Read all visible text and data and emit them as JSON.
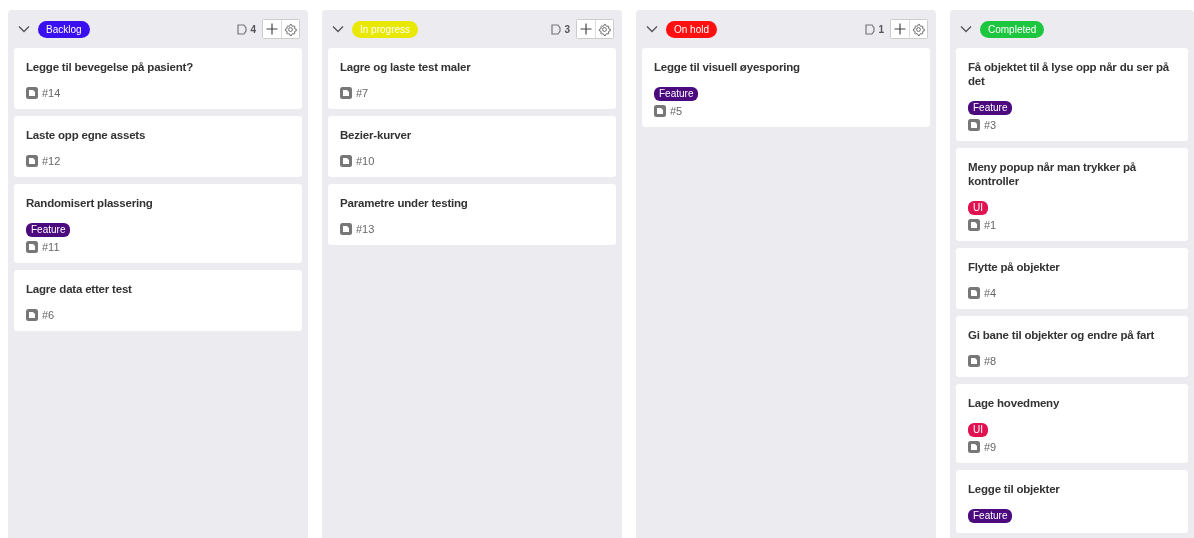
{
  "columns": [
    {
      "status": "Backlog",
      "color": "#3a10f0",
      "count": "4",
      "cards": [
        {
          "title": "Legge til bevegelse på pasient?",
          "issue": "#14"
        },
        {
          "title": "Laste opp egne assets",
          "issue": "#12"
        },
        {
          "title": "Randomisert plassering",
          "labels": [
            {
              "text": "Feature",
              "color": "#4b0a7e"
            }
          ],
          "issue": "#11"
        },
        {
          "title": "Lagre data etter test",
          "issue": "#6"
        }
      ]
    },
    {
      "status": "In progress",
      "color": "#e8e800",
      "count": "3",
      "cards": [
        {
          "title": "Lagre og laste test maler",
          "issue": "#7"
        },
        {
          "title": "Bezier-kurver",
          "issue": "#10"
        },
        {
          "title": "Parametre under testing",
          "issue": "#13"
        }
      ]
    },
    {
      "status": "On hold",
      "color": "#ff1010",
      "count": "1",
      "cards": [
        {
          "title": "Legge til visuell øyesporing",
          "labels": [
            {
              "text": "Feature",
              "color": "#4b0a7e"
            }
          ],
          "issue": "#5"
        }
      ]
    },
    {
      "status": "Completed",
      "color": "#1cc63f",
      "cards": [
        {
          "title": "Få objektet til å lyse opp når du ser på det",
          "labels": [
            {
              "text": "Feature",
              "color": "#4b0a7e"
            }
          ],
          "issue": "#3"
        },
        {
          "title": "Meny popup når man trykker på kontroller",
          "labels": [
            {
              "text": "UI",
              "color": "#e0124f"
            }
          ],
          "issue": "#1"
        },
        {
          "title": "Flytte på objekter",
          "issue": "#4"
        },
        {
          "title": "Gi bane til objekter og endre på fart",
          "issue": "#8"
        },
        {
          "title": "Lage hovedmeny",
          "labels": [
            {
              "text": "UI",
              "color": "#e0124f"
            }
          ],
          "issue": "#9"
        },
        {
          "title": "Legge til objekter",
          "labels": [
            {
              "text": "Feature",
              "color": "#4b0a7e"
            }
          ]
        }
      ]
    }
  ]
}
